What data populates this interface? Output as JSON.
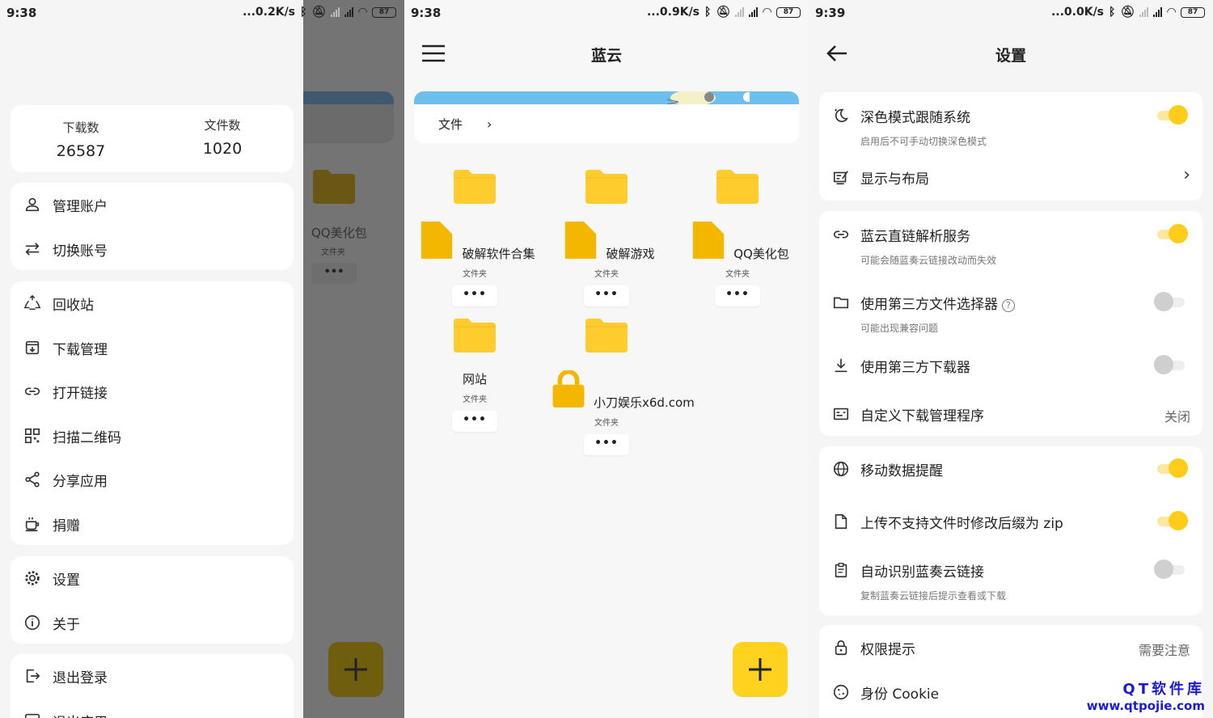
{
  "screens": [
    {
      "status": {
        "time": "9:38",
        "speed": "...0.2K/s",
        "battery": "87"
      }
    },
    {
      "status": {
        "time": "9:38",
        "speed": "...0.9K/s",
        "battery": "87"
      }
    },
    {
      "status": {
        "time": "9:39",
        "speed": "...0.0K/s",
        "battery": "87"
      }
    }
  ],
  "drawer": {
    "stats": [
      {
        "label": "下载数",
        "value": "26587"
      },
      {
        "label": "文件数",
        "value": "1020"
      }
    ],
    "group1": [
      {
        "label": "管理账户",
        "icon": "person-icon"
      },
      {
        "label": "切换账号",
        "icon": "swap-icon"
      }
    ],
    "group2": [
      {
        "label": "回收站",
        "icon": "recycle-icon"
      },
      {
        "label": "下载管理",
        "icon": "download-box-icon"
      },
      {
        "label": "打开链接",
        "icon": "link-icon"
      },
      {
        "label": "扫描二维码",
        "icon": "qr-icon"
      },
      {
        "label": "分享应用",
        "icon": "share-icon"
      },
      {
        "label": "捐赠",
        "icon": "coffee-icon"
      }
    ],
    "group3": [
      {
        "label": "设置",
        "icon": "gear-icon"
      },
      {
        "label": "关于",
        "icon": "info-icon"
      }
    ],
    "group4": [
      {
        "label": "退出登录",
        "icon": "logout-icon"
      },
      {
        "label": "退出应用",
        "icon": "exit-icon"
      }
    ],
    "peek": {
      "folder_name": "QQ美化包",
      "folder_sub": "文件夹",
      "more": "•••"
    }
  },
  "main": {
    "title": "蓝云",
    "breadcrumb": "文件",
    "folders": [
      {
        "name": "破解软件合集",
        "sub": "文件夹",
        "more": "•••",
        "badge": "file"
      },
      {
        "name": "破解游戏",
        "sub": "文件夹",
        "more": "•••",
        "badge": "file"
      },
      {
        "name": "QQ美化包",
        "sub": "文件夹",
        "more": "•••",
        "badge": "file"
      },
      {
        "name": "网站",
        "sub": "文件夹",
        "more": "•••",
        "badge": ""
      },
      {
        "name": "小刀娱乐x6d.com",
        "sub": "文件夹",
        "more": "•••",
        "badge": "lock"
      }
    ],
    "fab": "+"
  },
  "settings": {
    "title": "设置",
    "groups": [
      [
        {
          "title": "深色模式跟随系统",
          "desc": "启用后不可手动切换深色模式",
          "toggle": true
        },
        {
          "title": "显示与布局",
          "arrow": true
        }
      ],
      [
        {
          "title": "蓝云直链解析服务",
          "desc": "可能会随蓝奏云链接改动而失效",
          "toggle": true
        },
        {
          "title": "使用第三方文件选择器",
          "desc": "可能出现兼容问题",
          "toggle": false,
          "help": true
        },
        {
          "title": "使用第三方下载器",
          "toggle": false
        },
        {
          "title": "自定义下载管理程序",
          "value": "关闭"
        }
      ],
      [
        {
          "title": "移动数据提醒",
          "toggle": true
        },
        {
          "title": "上传不支持文件时修改后缀为 zip",
          "toggle": true
        },
        {
          "title": "自动识别蓝奏云链接",
          "desc": "复制蓝奏云链接后提示查看或下载",
          "toggle": false
        }
      ],
      [
        {
          "title": "权限提示",
          "value": "需要注意"
        },
        {
          "title": "身份 Cookie"
        }
      ]
    ]
  },
  "watermark": {
    "line1": "QT软件库",
    "line2": "www.qtpojie.com"
  },
  "colors": {
    "accent": "#ffd21f",
    "folder": "#ffcc2e",
    "peek_bg": "#747474"
  }
}
